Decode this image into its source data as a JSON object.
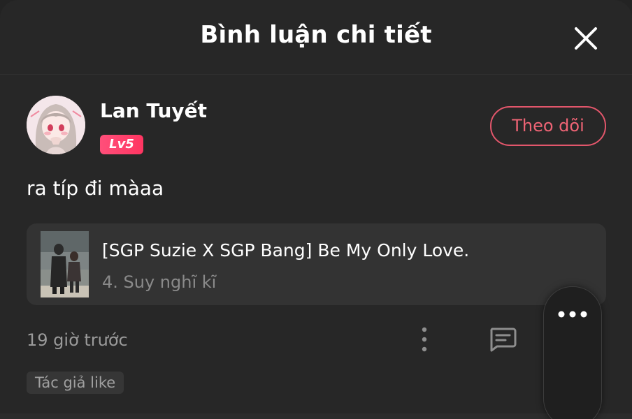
{
  "header": {
    "title": "Bình luận chi tiết",
    "close_icon": "close-icon"
  },
  "comment": {
    "user": {
      "name": "Lan Tuyết",
      "level": "Lv5",
      "avatar_icon": "anime-girl-avatar"
    },
    "follow_label": "Theo dõi",
    "text": "ra típ đi màaa",
    "linked_story": {
      "title": "[SGP Suzie X SGP Bang] Be My Only Love.",
      "chapter": "4. Suy nghĩ kĩ",
      "thumbnail": "couple-photo-thumbnail"
    },
    "time": "19 giờ trước",
    "author_like": "Tác giả like"
  },
  "icons": {
    "more": "more-vertical-icon",
    "reply": "reply-comment-icon",
    "float_menu": "more-horizontal-icon"
  },
  "colors": {
    "background": "#272727",
    "accent": "#ee6475",
    "level_badge": "#ff3561",
    "card": "#333333"
  }
}
